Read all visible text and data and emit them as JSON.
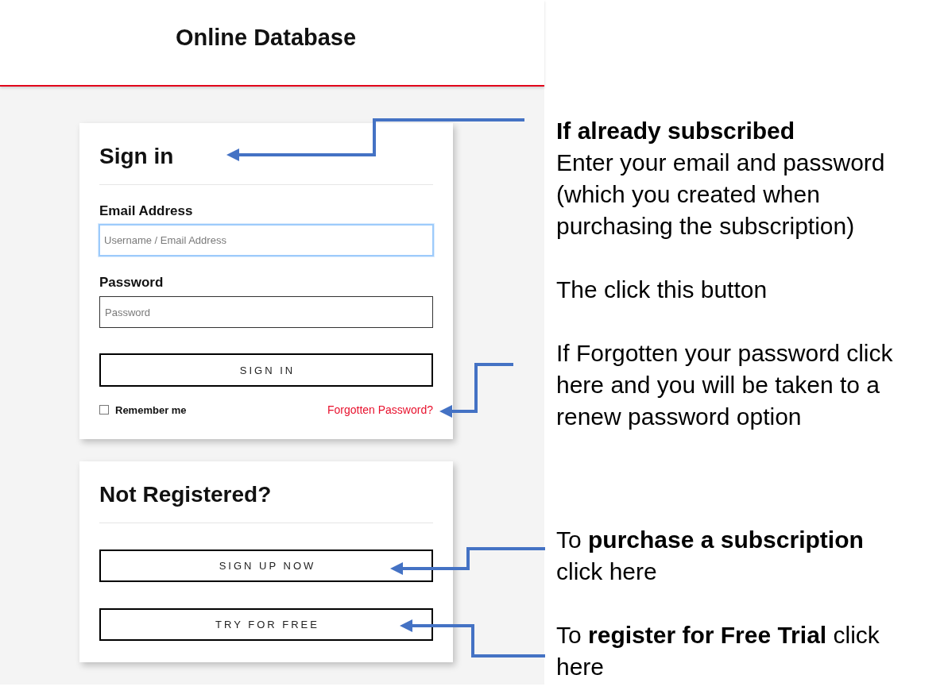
{
  "header": {
    "title": "Online Database"
  },
  "sign_in": {
    "title": "Sign in",
    "fields": [
      {
        "label": "Email Address",
        "placeholder": "Username / Email Address",
        "focused": true
      },
      {
        "label": "Password",
        "placeholder": "Password",
        "focused": false
      }
    ],
    "button": "SIGN IN",
    "remember_me": {
      "label": "Remember me",
      "checked": false
    },
    "forgot_link": "Forgotten Password?"
  },
  "register": {
    "title": "Not Registered?",
    "buttons": [
      "SIGN UP NOW",
      "TRY FOR FREE"
    ]
  },
  "annotations": [
    {
      "notes": [
        {
          "heading": "If already subscribed",
          "text": "Enter your email and password (which you created when purchasing the subscription)"
        },
        {
          "text": "The click this button"
        },
        {
          "text": "If Forgotten your password click here and you will be taken to a renew password option"
        }
      ]
    },
    {
      "notes": [
        {
          "text": "To **purchase a subscription** click here"
        },
        {
          "text": "To **register for Free Trial** click here"
        }
      ]
    }
  ]
}
